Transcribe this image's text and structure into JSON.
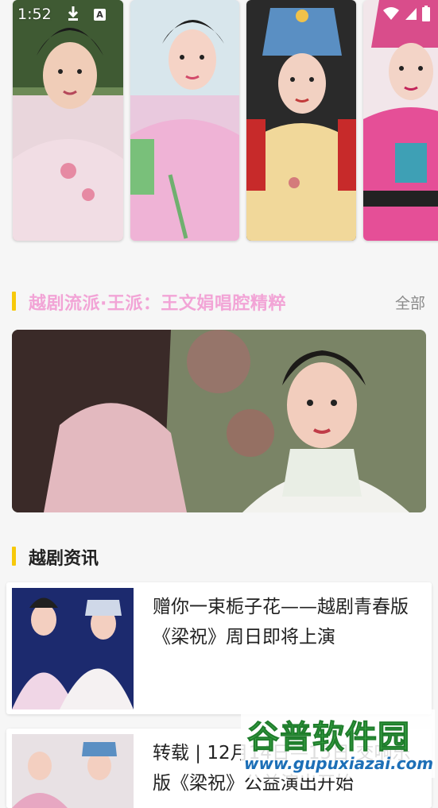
{
  "status_bar": {
    "time": "1:52"
  },
  "top_cards": [
    {
      "name": "opera-photo-1"
    },
    {
      "name": "opera-photo-2"
    },
    {
      "name": "opera-photo-3"
    },
    {
      "name": "opera-photo-4"
    }
  ],
  "section_featured": {
    "title": "越剧流派·王派：王文娟唱腔精粹",
    "more_label": "全部",
    "accent_color": "#f2a4d6",
    "bar_color": "#f7c90a"
  },
  "section_news": {
    "title": "越剧资讯",
    "items": [
      {
        "title": "赠你一束栀子花——越剧青春版《梁祝》周日即将上演"
      },
      {
        "title": "转载 | 12月14日—15日 交响乐版《梁祝》公益演出开始"
      }
    ]
  },
  "watermark": {
    "text": "谷普软件园",
    "url": "www.gupuxiazai.com"
  }
}
